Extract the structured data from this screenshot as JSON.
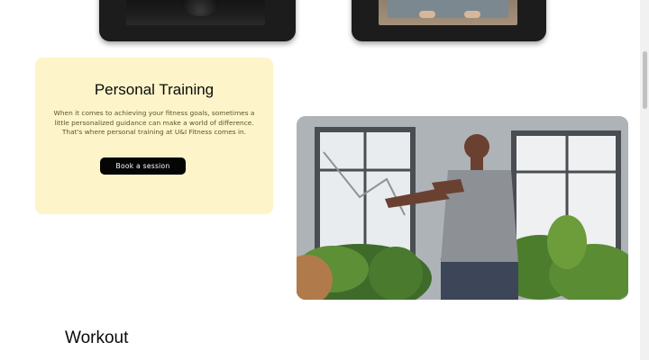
{
  "gallery": {
    "left_image_icon": "dark-workout-photo-icon",
    "right_image_icon": "yoga-mat-photo-icon"
  },
  "training": {
    "title": "Personal Training",
    "description": "When it comes to achieving your fitness goals, sometimes a little personalized guidance can make a world of difference. That's where personal training at U&I Fitness comes in.",
    "button_label": "Book a session",
    "card_color": "#fdf5c9",
    "button_color": "#050505"
  },
  "workout": {
    "heading": "Workout"
  }
}
